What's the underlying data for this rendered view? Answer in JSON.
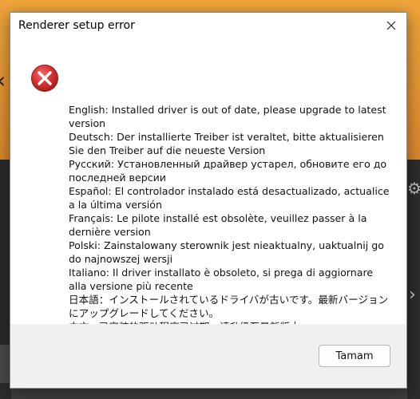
{
  "dialog": {
    "title": "Renderer setup error",
    "close_icon": "close-icon",
    "error_icon": "error-x-icon",
    "messages": [
      "English: Installed driver is out of date, please upgrade to latest version",
      "Deutsch: Der installierte Treiber ist veraltet, bitte aktualisieren Sie den Treiber auf die neueste Version",
      "Русский: Установленный драйвер устарел, обновите его до последней версии",
      "Español: El controlador instalado está desactualizado, actualice a la última versión",
      "Français: Le pilote installé est obsolète, veuillez passer à la dernière version",
      "Polski: Zainstalowany sterownik jest nieaktualny, uaktualnij go do najnowszej wersji",
      "Italiano: Il driver installato è obsoleto, si prega di aggiornare alla versione più recente",
      "日本語：インストールされているドライバが古いです。最新バージョンにアップグレードしてください。",
      "中文：已安装的驱动程序已过期，请升级至最新版本"
    ],
    "ok_label": "Tamam"
  },
  "colors": {
    "error_red": "#d62f2f",
    "dialog_bg": "#ffffff",
    "footer_bg": "#f0f0f0"
  }
}
